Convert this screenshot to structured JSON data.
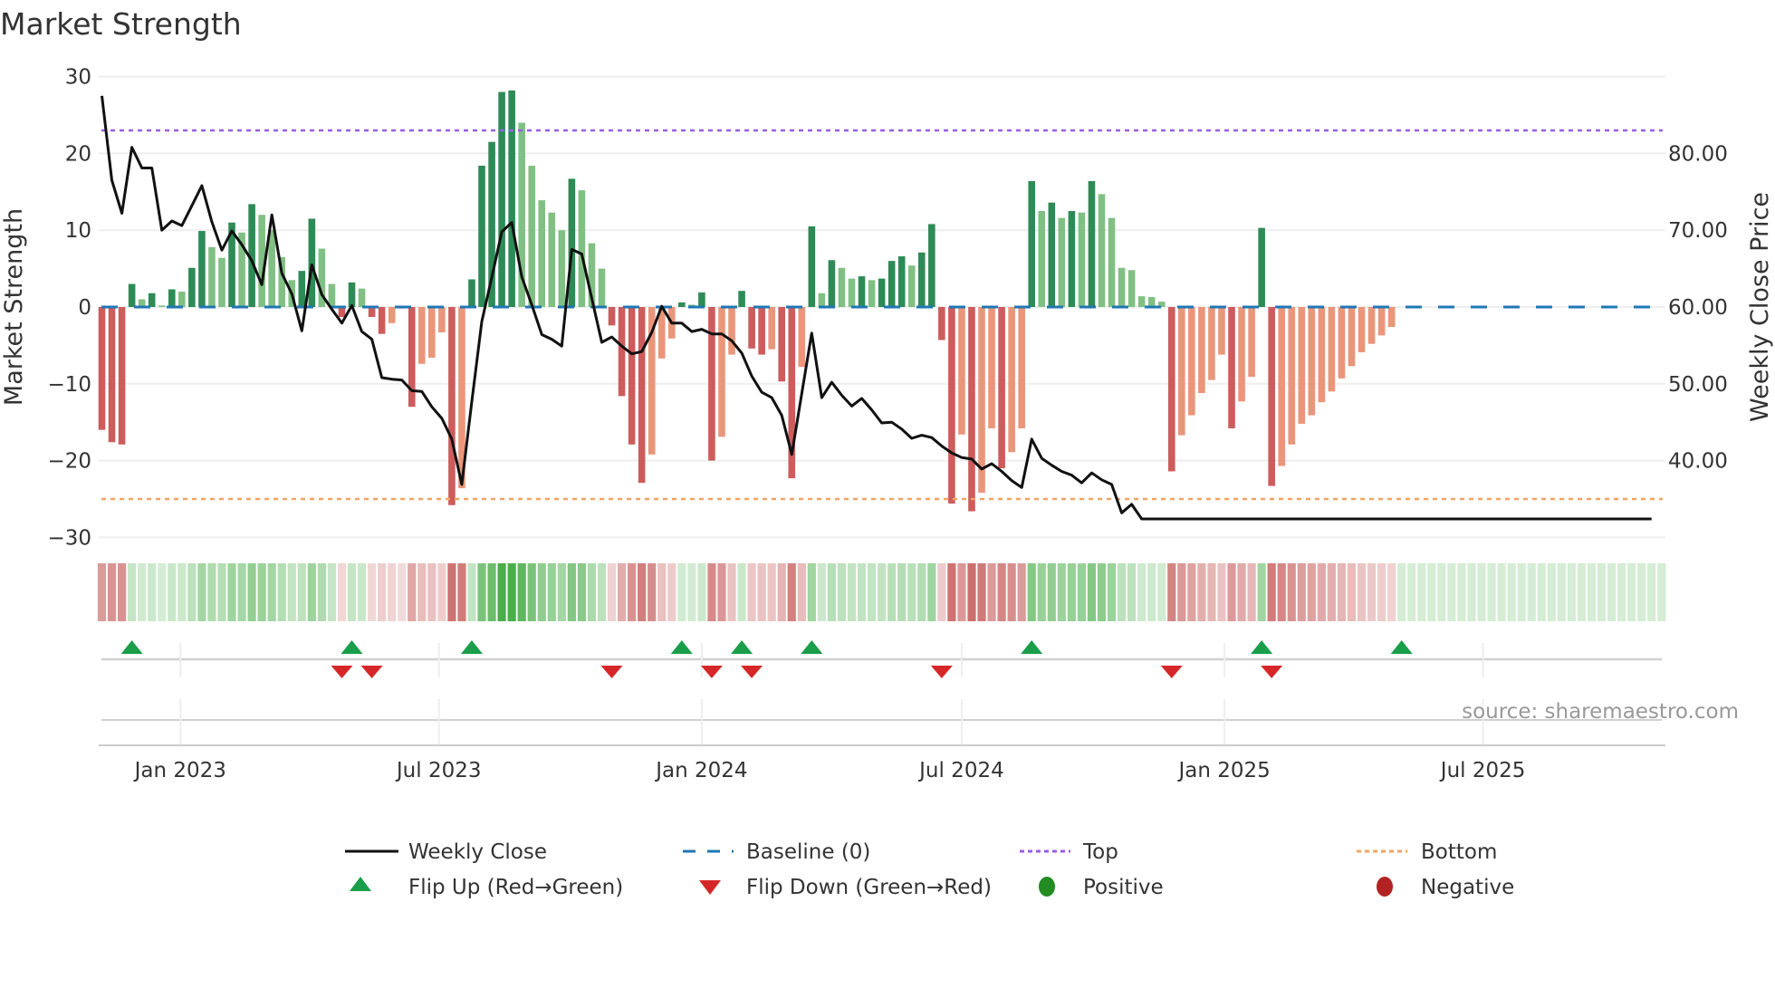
{
  "chart_data": {
    "type": "bar",
    "title": "Market Strength",
    "ylabel": "Market Strength",
    "ylabel_right": "Weekly Close Price",
    "ylim": [
      -30,
      30
    ],
    "ylim_right": [
      30,
      90
    ],
    "yticks": [
      "30",
      "20",
      "10",
      "0",
      "−10",
      "−20",
      "−30"
    ],
    "ytick_values": [
      30,
      20,
      10,
      0,
      -10,
      -20,
      -30
    ],
    "yticks_right": [
      "80.00",
      "70.00",
      "60.00",
      "50.00",
      "40.00"
    ],
    "ytick_right_values": [
      80,
      70,
      60,
      50,
      40
    ],
    "x_start": "2022-11-07",
    "x_step_days": 7,
    "xticks": [
      {
        "label": "Jan 2023",
        "date": "2023-01-01"
      },
      {
        "label": "Jul 2023",
        "date": "2023-07-01"
      },
      {
        "label": "Jan 2024",
        "date": "2024-01-01"
      },
      {
        "label": "Jul 2024",
        "date": "2024-07-01"
      },
      {
        "label": "Jan 2025",
        "date": "2025-01-01"
      },
      {
        "label": "Jul 2025",
        "date": "2025-07-01"
      }
    ],
    "top_level": 23,
    "bottom_level": -25,
    "baseline": 0,
    "strength": [
      -16.0,
      -17.6,
      -17.9,
      3.0,
      1.0,
      1.8,
      0.2,
      2.3,
      2.0,
      5.1,
      9.9,
      7.8,
      6.4,
      11.0,
      9.7,
      13.4,
      12.0,
      10.0,
      6.5,
      3.5,
      4.7,
      11.5,
      7.6,
      3.0,
      -1.3,
      3.2,
      2.4,
      -1.3,
      -3.5,
      -2.1,
      -0.2,
      -13.0,
      -7.4,
      -6.6,
      -3.3,
      -25.8,
      -23.6,
      3.6,
      18.4,
      21.5,
      28.0,
      28.2,
      24.0,
      18.4,
      13.9,
      12.3,
      10.0,
      16.7,
      15.2,
      8.3,
      5.0,
      -2.4,
      -11.6,
      -17.9,
      -22.9,
      -19.2,
      -6.7,
      -4.1,
      0.6,
      0.3,
      1.9,
      -20.0,
      -16.9,
      -6.2,
      2.1,
      -5.4,
      -6.2,
      -5.5,
      -9.7,
      -22.3,
      -7.8,
      10.5,
      1.8,
      6.1,
      5.1,
      3.7,
      4.0,
      3.5,
      3.7,
      6.0,
      6.6,
      5.4,
      7.1,
      10.8,
      -4.3,
      -25.6,
      -16.6,
      -26.6,
      -24.2,
      -15.8,
      -21.0,
      -18.9,
      -15.8,
      16.4,
      12.5,
      13.6,
      11.6,
      12.5,
      12.3,
      16.4,
      14.7,
      11.6,
      5.1,
      4.8,
      1.4,
      1.3,
      0.7,
      -21.4,
      -16.7,
      -14.1,
      -11.2,
      -9.5,
      -6.2,
      -15.8,
      -12.3,
      -9.1,
      10.3,
      -23.3,
      -20.7,
      -17.9,
      -15.2,
      -14.1,
      -12.4,
      -11.0,
      -9.3,
      -7.7,
      -5.9,
      -4.8,
      -3.7,
      -2.6,
      0,
      0,
      0,
      0,
      0,
      0,
      0,
      0,
      0,
      0,
      0,
      0,
      0,
      0,
      0,
      0,
      0,
      0,
      0,
      0,
      0,
      0,
      0,
      0,
      0,
      0,
      0
    ],
    "weekly_close": [
      87.5,
      76.5,
      72.2,
      80.8,
      78.1,
      78.1,
      70.0,
      71.2,
      70.6,
      73.2,
      75.8,
      71.1,
      67.4,
      69.9,
      68.1,
      66.0,
      62.9,
      72.0,
      64.4,
      61.7,
      56.9,
      65.5,
      61.6,
      59.7,
      57.9,
      60.2,
      56.8,
      55.8,
      50.8,
      50.6,
      50.5,
      49.1,
      49.0,
      47.0,
      45.5,
      42.8,
      36.9,
      47.7,
      58.1,
      63.9,
      69.8,
      71.0,
      63.9,
      60.3,
      56.4,
      55.8,
      54.9,
      67.5,
      66.9,
      61.1,
      55.4,
      56.1,
      54.9,
      53.9,
      54.2,
      56.7,
      60.1,
      57.9,
      57.9,
      56.8,
      57.1,
      56.5,
      56.5,
      55.6,
      54.0,
      51.0,
      48.9,
      48.2,
      45.9,
      40.8,
      48.7,
      56.6,
      48.2,
      50.2,
      48.5,
      47.1,
      48.1,
      46.6,
      44.9,
      45.0,
      44.1,
      42.9,
      43.3,
      43.0,
      41.9,
      41.0,
      40.4,
      40.2,
      38.9,
      39.6,
      38.6,
      37.4,
      36.5,
      42.8,
      40.3,
      39.4,
      38.6,
      38.1,
      37.1,
      38.4,
      37.5,
      36.9,
      33.2,
      34.3,
      32.4,
      32.4,
      32.4,
      32.4,
      32.4,
      32.4,
      32.4,
      32.4,
      32.4,
      32.4,
      32.4,
      32.4,
      32.4,
      32.4,
      32.4,
      32.4,
      32.4,
      32.4,
      32.4,
      32.4,
      32.4,
      32.4,
      32.4,
      32.4,
      32.4,
      32.4,
      32.4,
      32.4,
      32.4,
      32.4,
      32.4,
      32.4,
      32.4,
      32.4,
      32.4,
      32.4,
      32.4,
      32.4,
      32.4,
      32.4,
      32.4,
      32.4,
      32.4,
      32.4,
      32.4,
      32.4,
      32.4,
      32.4,
      32.4,
      32.4,
      32.4,
      32.4
    ],
    "flip_up_weeks": [
      4,
      26,
      38,
      59,
      65,
      72,
      94,
      117,
      131
    ],
    "flip_down_weeks": [
      25,
      28,
      52,
      62,
      66,
      85,
      108,
      118
    ],
    "legend": [
      {
        "label": "Weekly Close",
        "kind": "line"
      },
      {
        "label": "Baseline (0)",
        "kind": "dashed"
      },
      {
        "label": "Top",
        "kind": "dotted-top"
      },
      {
        "label": "Bottom",
        "kind": "dotted-bottom"
      },
      {
        "label": "Flip Up (Red→Green)",
        "kind": "tri-up"
      },
      {
        "label": "Flip Down (Green→Red)",
        "kind": "tri-down"
      },
      {
        "label": "Positive",
        "kind": "dot-pos"
      },
      {
        "label": "Negative",
        "kind": "dot-neg"
      }
    ],
    "legend_placement": "bottom",
    "grid": true,
    "source": "source: sharemaestro.com",
    "colors": {
      "pos_strong": "#2e8b57",
      "pos_weak": "#81c084",
      "neg_strong": "#cd5c5c",
      "neg_weak": "#e9967a",
      "line": "#111111",
      "baseline": "#1f77b4",
      "top": "#9b5de5",
      "bottom": "#f4a460",
      "flip_up": "#1a9e4a",
      "flip_down": "#d62728",
      "positive": "#228b22",
      "negative": "#b22222",
      "heat_pos": "#2ca02c",
      "heat_neg": "#c0504d"
    }
  }
}
